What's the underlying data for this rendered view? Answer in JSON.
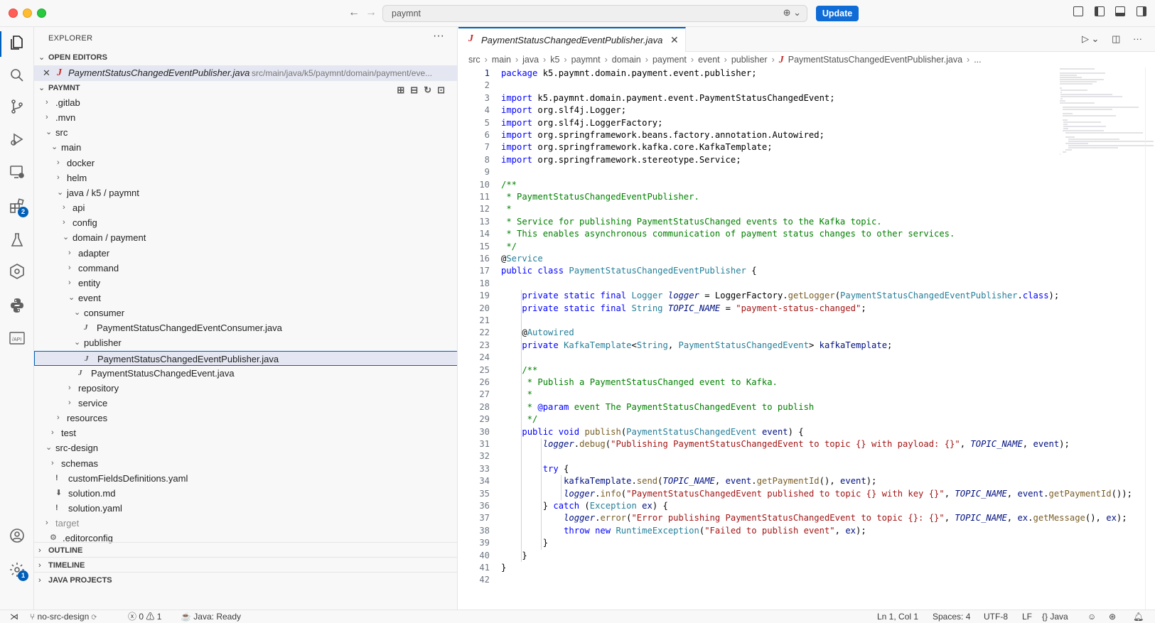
{
  "titlebar": {
    "search_text": "paymnt",
    "update_label": "Update"
  },
  "activity": {
    "extensions_badge": "2",
    "settings_badge": "1"
  },
  "sidebar": {
    "title": "EXPLORER",
    "open_editors_label": "OPEN EDITORS",
    "open_editor_file": "PaymentStatusChangedEventPublisher.java",
    "open_editor_path": "src/main/java/k5/paymnt/domain/payment/eve...",
    "project_label": "PAYMNT",
    "tree": [
      {
        "label": ".gitlab",
        "depth": 0,
        "chevron": ">"
      },
      {
        "label": ".mvn",
        "depth": 0,
        "chevron": ">"
      },
      {
        "label": "src",
        "depth": 0,
        "chevron": "v"
      },
      {
        "label": "main",
        "depth": 1,
        "chevron": "v"
      },
      {
        "label": "docker",
        "depth": 2,
        "chevron": ">"
      },
      {
        "label": "helm",
        "depth": 2,
        "chevron": ">"
      },
      {
        "label": "java / k5 / paymnt",
        "depth": 2,
        "chevron": "v"
      },
      {
        "label": "api",
        "depth": 3,
        "chevron": ">"
      },
      {
        "label": "config",
        "depth": 3,
        "chevron": ">"
      },
      {
        "label": "domain / payment",
        "depth": 3,
        "chevron": "v"
      },
      {
        "label": "adapter",
        "depth": 4,
        "chevron": ">"
      },
      {
        "label": "command",
        "depth": 4,
        "chevron": ">"
      },
      {
        "label": "entity",
        "depth": 4,
        "chevron": ">"
      },
      {
        "label": "event",
        "depth": 4,
        "chevron": "v"
      },
      {
        "label": "consumer",
        "depth": 5,
        "chevron": "v"
      },
      {
        "label": "PaymentStatusChangedEventConsumer.java",
        "depth": 6,
        "chevron": "",
        "icon": "java"
      },
      {
        "label": "publisher",
        "depth": 5,
        "chevron": "v"
      },
      {
        "label": "PaymentStatusChangedEventPublisher.java",
        "depth": 6,
        "chevron": "",
        "icon": "java",
        "selected": true
      },
      {
        "label": "PaymentStatusChangedEvent.java",
        "depth": 5,
        "chevron": "",
        "icon": "java"
      },
      {
        "label": "repository",
        "depth": 4,
        "chevron": ">"
      },
      {
        "label": "service",
        "depth": 4,
        "chevron": ">"
      },
      {
        "label": "resources",
        "depth": 2,
        "chevron": ">"
      },
      {
        "label": "test",
        "depth": 1,
        "chevron": ">"
      },
      {
        "label": "src-design",
        "depth": 0,
        "chevron": "v"
      },
      {
        "label": "schemas",
        "depth": 1,
        "chevron": ">"
      },
      {
        "label": "customFieldsDefinitions.yaml",
        "depth": 1,
        "chevron": "",
        "icon": "yaml"
      },
      {
        "label": "solution.md",
        "depth": 1,
        "chevron": "",
        "icon": "md"
      },
      {
        "label": "solution.yaml",
        "depth": 1,
        "chevron": "",
        "icon": "yaml"
      },
      {
        "label": "target",
        "depth": 0,
        "chevron": ">",
        "muted": true
      },
      {
        "label": ".editorconfig",
        "depth": 0,
        "chevron": "",
        "icon": "gear"
      }
    ],
    "outline_label": "OUTLINE",
    "timeline_label": "TIMELINE",
    "java_projects_label": "JAVA PROJECTS"
  },
  "editor": {
    "tab_title": "PaymentStatusChangedEventPublisher.java",
    "breadcrumb": [
      "src",
      "main",
      "java",
      "k5",
      "paymnt",
      "domain",
      "payment",
      "event",
      "publisher"
    ],
    "breadcrumb_file": "PaymentStatusChangedEventPublisher.java",
    "breadcrumb_tail": "...",
    "lines": [
      "package k5.paymnt.domain.payment.event.publisher;",
      "",
      "import k5.paymnt.domain.payment.event.PaymentStatusChangedEvent;",
      "import org.slf4j.Logger;",
      "import org.slf4j.LoggerFactory;",
      "import org.springframework.beans.factory.annotation.Autowired;",
      "import org.springframework.kafka.core.KafkaTemplate;",
      "import org.springframework.stereotype.Service;",
      "",
      "/**",
      " * PaymentStatusChangedEventPublisher.",
      " *",
      " * Service for publishing PaymentStatusChanged events to the Kafka topic.",
      " * This enables asynchronous communication of payment status changes to other services.",
      " */",
      "@Service",
      "public class PaymentStatusChangedEventPublisher {",
      "",
      "    private static final Logger logger = LoggerFactory.getLogger(PaymentStatusChangedEventPublisher.class);",
      "    private static final String TOPIC_NAME = \"payment-status-changed\";",
      "",
      "    @Autowired",
      "    private KafkaTemplate<String, PaymentStatusChangedEvent> kafkaTemplate;",
      "",
      "    /**",
      "     * Publish a PaymentStatusChanged event to Kafka.",
      "     *",
      "     * @param event The PaymentStatusChangedEvent to publish",
      "     */",
      "    public void publish(PaymentStatusChangedEvent event) {",
      "        logger.debug(\"Publishing PaymentStatusChangedEvent to topic {} with payload: {}\", TOPIC_NAME, event);",
      "",
      "        try {",
      "            kafkaTemplate.send(TOPIC_NAME, event.getPaymentId(), event);",
      "            logger.info(\"PaymentStatusChangedEvent published to topic {} with key {}\", TOPIC_NAME, event.getPaymentId());",
      "        } catch (Exception ex) {",
      "            logger.error(\"Error publishing PaymentStatusChangedEvent to topic {}: {}\", TOPIC_NAME, ex.getMessage(), ex);",
      "            throw new RuntimeException(\"Failed to publish event\", ex);",
      "        }",
      "    }",
      "}",
      ""
    ]
  },
  "status": {
    "branch": "no-src-design",
    "errors": "0",
    "warnings": "1",
    "java_status": "Java: Ready",
    "position": "Ln 1, Col 1",
    "spaces": "Spaces: 4",
    "encoding": "UTF-8",
    "eol": "LF",
    "language": "Java"
  },
  "colors": {
    "accent": "#005fb8",
    "update_button": "#0f6cd6"
  }
}
